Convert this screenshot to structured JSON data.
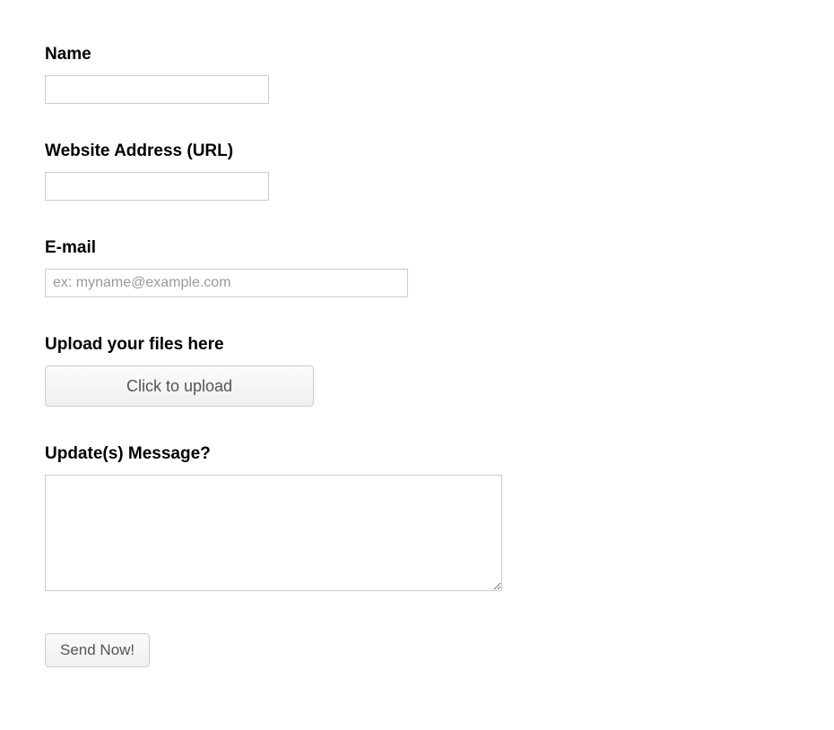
{
  "form": {
    "name": {
      "label": "Name",
      "value": ""
    },
    "url": {
      "label": "Website Address (URL)",
      "value": ""
    },
    "email": {
      "label": "E-mail",
      "placeholder": "ex: myname@example.com",
      "value": ""
    },
    "upload": {
      "label": "Upload your files here",
      "button_label": "Click to upload"
    },
    "message": {
      "label": "Update(s) Message?",
      "value": ""
    },
    "submit": {
      "label": "Send Now!"
    }
  }
}
